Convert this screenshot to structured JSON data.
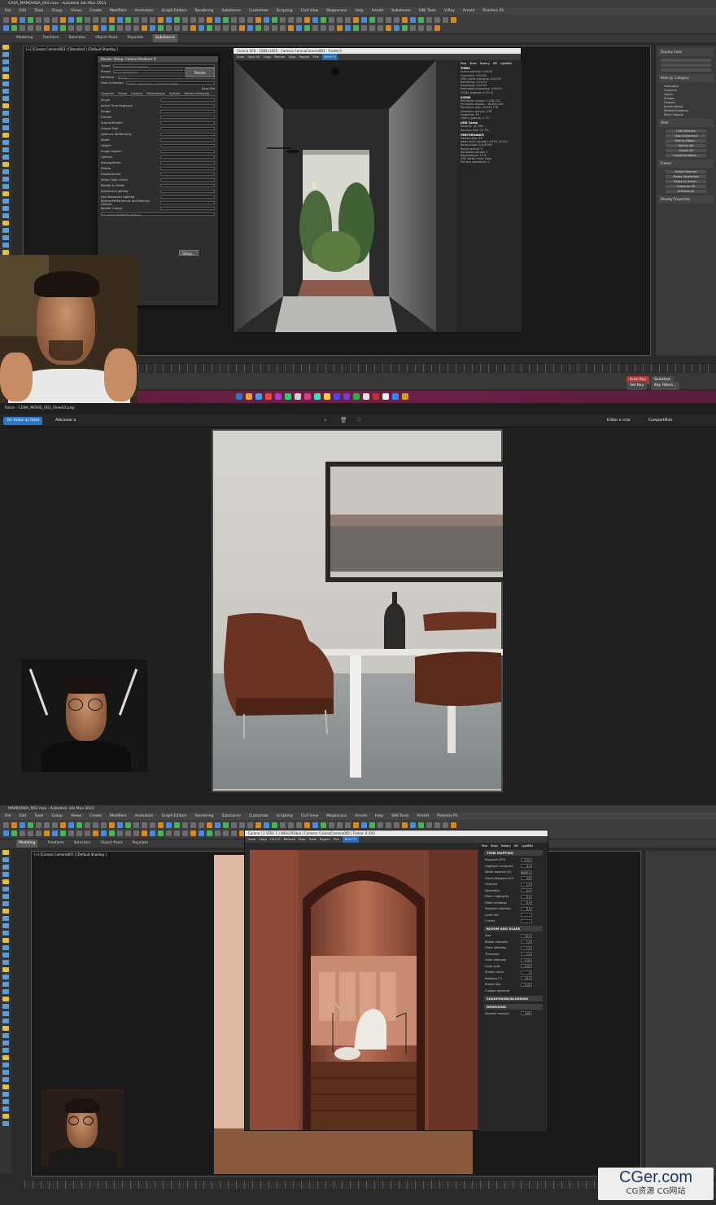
{
  "panel1": {
    "window_title": "CASA_MAMOVIDA_003.max - Autodesk 3ds Max 2023",
    "menus": [
      "File",
      "Edit",
      "Tools",
      "Group",
      "Views",
      "Create",
      "Modifiers",
      "Animation",
      "Graph Editors",
      "Rendering",
      "Substance",
      "Customize",
      "Scripting",
      "Civil View",
      "Megascans",
      "Help",
      "Arnold",
      "Substance",
      "SiNi Tools",
      "V-Ray",
      "Arnold",
      "Pixelmix PS"
    ],
    "ribbon_tabs": [
      "Modeling",
      "Freeform",
      "Selection",
      "Object Paint",
      "Populate",
      "Substance"
    ],
    "viewport_label": "[+] [Corona Camera003 ] [Standard ] [Default Shading ]",
    "render_dialog": {
      "title": "Render Setup: Corona Renderer 9",
      "target_label": "Target:",
      "target_value": "Production Rendering Mode",
      "preset_label": "Preset:",
      "preset_value": "No preset selected",
      "renderer_label": "Renderer:",
      "renderer_value": "Corona",
      "view_label": "View to Render:",
      "view_value": "Quad 4 - Perspective - CoronaCamera003",
      "render_button": "Render",
      "save_file": "Save File",
      "tabs": [
        "Common",
        "Scene",
        "Camera",
        "Performance",
        "System",
        "Render Elements"
      ],
      "rows": [
        "Single",
        "Active Time Segment:",
        "Range:",
        "Frames",
        "Area to Render",
        "Output Size",
        "Aperture Width(mm):",
        "Width:",
        "Height:",
        "Image Aspect:",
        "Options",
        "Atmospherics",
        "Effects",
        "Displacement",
        "Video Color Check",
        "Render to Fields",
        "Advanced Lighting",
        "Use Advanced Lighting",
        "Bitmap Performance and Memory Options",
        "Render Output"
      ],
      "output_path": "C:\\...\\CASA_MAMOVIDA_003.png",
      "setup_button": "Setup..."
    },
    "vfb": {
      "title": "Corona VFB - 1080x1920 - Camera CoronaCamera003 - Frame 0",
      "toolbar": [
        "Save",
        "Save All",
        "Copy",
        "Render",
        "Stop",
        "Region",
        "Pick",
        "BEAUTY"
      ],
      "stats_tabs": [
        "Post",
        "Stats",
        "History",
        "DR",
        "LightMix"
      ],
      "stats_sections": [
        {
          "head": "TIMES",
          "lines": [
            "Scene parsing: 0:00:01",
            "Geometry: 0:00:00",
            "UHD cache precomp: 0:00:02",
            "Rendering: 0:15:01",
            "Denoising: 0:00:05",
            "Estimated remaining: 0:00:00",
            "TOTAL elapsed: 0:15:12"
          ]
        },
        {
          "head": "SCENE",
          "lines": [
            "Primitives unique: 2,478,751",
            "Primitives displac.: 16,896,028",
            "Primitives disk: 24,451,778",
            "Geometry groups: 278",
            "Instances: 29",
            "Lights (groups): 1 (2)"
          ]
        },
        {
          "head": "UHD Cache",
          "lines": [
            "Records: 42,706",
            "Success rate: 22.7%"
          ]
        },
        {
          "head": "PERFORMANCE",
          "lines": [
            "Passes total: 46",
            "Noise level (target): 4.93% (2.0%)",
            "Rays/s total: 5,428,901",
            "Rays/s actual: 0",
            "Samples/s actual: 0",
            "Rays/sample: 21.8",
            "VFB refresh time: 8ms",
            "Primary samples/s: 0"
          ]
        }
      ]
    },
    "cmd_panel": {
      "sections": [
        "Display Color",
        "Hide by Category",
        "Hide",
        "Freeze",
        "Display Properties"
      ],
      "category_items": [
        "Geometry",
        "Cameras",
        "Lights",
        "Shapes",
        "Helpers",
        "Space Warps",
        "Particle Systems",
        "Bone Objects"
      ],
      "buttons": [
        "Hide Selected",
        "Hide Unselected",
        "Hide by Name...",
        "Hide by Hit",
        "Unhide All",
        "Unhide by Name...",
        "Freeze Selected",
        "Freeze Unselected",
        "Freeze by Name...",
        "Freeze by Hit",
        "Unfreeze All"
      ]
    },
    "status": {
      "autokey": "Auto Key",
      "selected": "Selected",
      "setkey": "Set Key",
      "keyfilters": "Key Filters..."
    }
  },
  "panel2": {
    "title": "Fotos - CENA_MOVIE_003_View03.png",
    "back_label": "Ver todas as fotos",
    "add_label": "Adicionar a",
    "edit_label": "Editar e criar",
    "share_label": "Compartilhar"
  },
  "panel3": {
    "window_title": "MAMOVIDA_003.max - Autodesk 3ds Max 2023",
    "menus": [
      "File",
      "Edit",
      "Tools",
      "Group",
      "Views",
      "Create",
      "Modifiers",
      "Animation",
      "Graph Editors",
      "Rendering",
      "Substance",
      "Customize",
      "Scripting",
      "Civil View",
      "Megascans",
      "Arnold",
      "Help",
      "SiNi Tools",
      "Arnold",
      "Pixelmix PS"
    ],
    "ribbon_tabs": [
      "Modeling",
      "Freeform",
      "Selection",
      "Object Paint",
      "Populate"
    ],
    "viewport_label": "[+] [Corona Camera005 ] [Default Shading ]",
    "vfb": {
      "title": "Corona | 2 VFB-l 1 | 960x1920px | Camera: CoronaCamera005 | Frame: 0 (00)",
      "toolbar": [
        "Save",
        "Copy",
        "Ctrl+C",
        "Refresh",
        "Stop",
        "Tools",
        "Region",
        "Pick",
        "BEAUTY"
      ],
      "tabs": [
        "Post",
        "Stats",
        "History",
        "DR",
        "LightMix"
      ],
      "tone_mapping": {
        "head": "TONE MAPPING",
        "rows": [
          {
            "label": "Exposure (EV)",
            "value": "-0.50"
          },
          {
            "label": "Highlight compress",
            "value": "3.0"
          },
          {
            "label": "White balance (K)",
            "value": "6500.0"
          },
          {
            "label": "Green-Magenta tint",
            "value": "0.0"
          },
          {
            "label": "Contrast",
            "value": "1.0"
          },
          {
            "label": "Saturation",
            "value": "0.0"
          },
          {
            "label": "Filmic highlights",
            "value": "0.0"
          },
          {
            "label": "Filmic shadows",
            "value": "0.0"
          },
          {
            "label": "Vignette intensity",
            "value": "0.0"
          },
          {
            "label": "Color tint",
            "value": ""
          },
          {
            "label": "Curves",
            "value": ""
          }
        ]
      },
      "bloom": {
        "head": "BLOOM AND GLARE",
        "rows": [
          {
            "label": "Size",
            "value": "15.0"
          },
          {
            "label": "Bloom intensity",
            "value": "1.0"
          },
          {
            "label": "Glare intensity",
            "value": "1.0"
          },
          {
            "label": "Threshold",
            "value": "1.0"
          },
          {
            "label": "Color intensity",
            "value": "0.50"
          },
          {
            "label": "Color shift",
            "value": "0.50"
          },
          {
            "label": "Streak count",
            "value": "3"
          },
          {
            "label": "Rotation (°)",
            "value": "15.0"
          },
          {
            "label": "Streak blur",
            "value": "0.20"
          }
        ],
        "custom_aperture": "Custom aperture"
      },
      "sharpening": "SHARPENING/BLURRING",
      "denoising": "DENOISING",
      "denoise_amount_label": "Denoise amount",
      "denoise_amount_value": "0.65"
    }
  },
  "watermark": {
    "line1": "CGer.com",
    "line2": "CG资源 CG网站"
  }
}
